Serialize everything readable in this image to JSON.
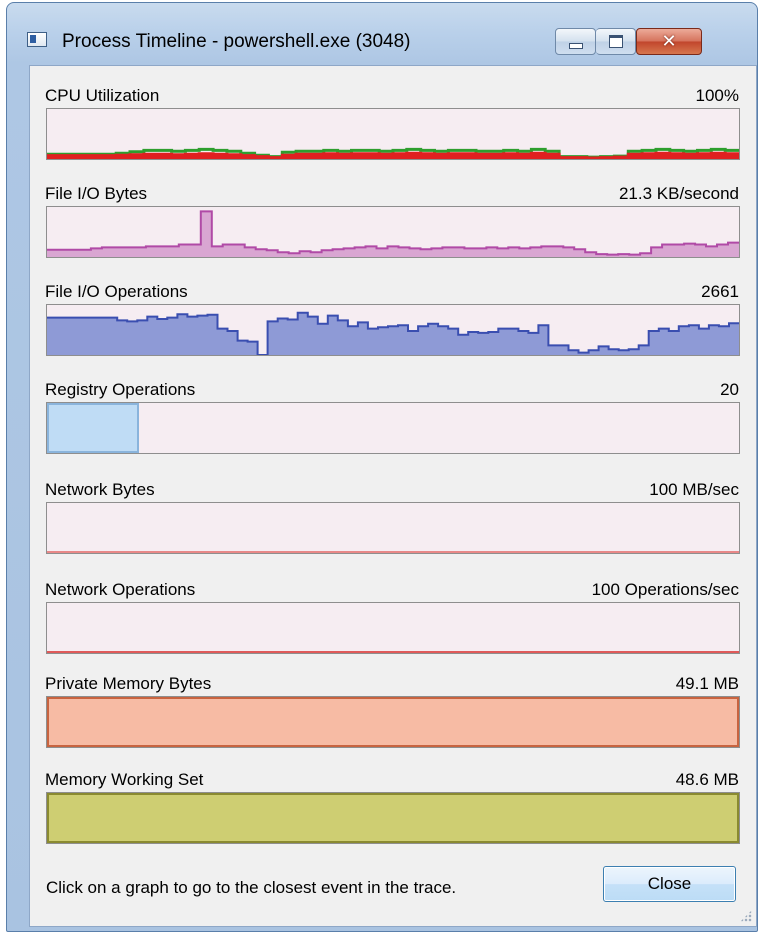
{
  "window": {
    "title": "Process Timeline - powershell.exe (3048)",
    "icons": {
      "app": "app-window-icon",
      "minimize": "minimize-icon",
      "maximize": "maximize-icon",
      "close": "close-x-icon"
    }
  },
  "graphs": [
    {
      "label": "CPU Utilization",
      "max": "100%",
      "kind": "multi-line",
      "series": [
        {
          "color": "#2e9e2e",
          "values": [
            0.1,
            0.1,
            0.1,
            0.1,
            0.1,
            0.12,
            0.15,
            0.18,
            0.18,
            0.16,
            0.18,
            0.2,
            0.18,
            0.16,
            0.12,
            0.08,
            0.05,
            0.14,
            0.16,
            0.16,
            0.18,
            0.16,
            0.18,
            0.18,
            0.16,
            0.18,
            0.2,
            0.18,
            0.16,
            0.18,
            0.18,
            0.16,
            0.16,
            0.18,
            0.16,
            0.2,
            0.16,
            0.05,
            0.05,
            0.04,
            0.05,
            0.06,
            0.16,
            0.18,
            0.2,
            0.18,
            0.16,
            0.18,
            0.2,
            0.18
          ]
        },
        {
          "color": "#e02020",
          "values": [
            0.07,
            0.07,
            0.07,
            0.07,
            0.07,
            0.08,
            0.09,
            0.1,
            0.1,
            0.09,
            0.1,
            0.11,
            0.1,
            0.09,
            0.07,
            0.05,
            0.03,
            0.08,
            0.1,
            0.1,
            0.11,
            0.1,
            0.11,
            0.11,
            0.1,
            0.11,
            0.12,
            0.11,
            0.1,
            0.11,
            0.11,
            0.1,
            0.1,
            0.11,
            0.1,
            0.12,
            0.1,
            0.03,
            0.03,
            0.02,
            0.03,
            0.04,
            0.1,
            0.11,
            0.12,
            0.11,
            0.1,
            0.11,
            0.12,
            0.11
          ]
        }
      ]
    },
    {
      "label": "File I/O Bytes",
      "max": "21.3 KB/second",
      "kind": "area",
      "fill": "#d9a6d2",
      "stroke": "#b04aa6",
      "values": [
        0.15,
        0.15,
        0.15,
        0.15,
        0.18,
        0.2,
        0.2,
        0.2,
        0.2,
        0.22,
        0.22,
        0.22,
        0.26,
        0.26,
        0.95,
        0.22,
        0.26,
        0.26,
        0.2,
        0.16,
        0.14,
        0.1,
        0.08,
        0.12,
        0.1,
        0.14,
        0.16,
        0.18,
        0.2,
        0.22,
        0.18,
        0.22,
        0.2,
        0.18,
        0.16,
        0.18,
        0.2,
        0.2,
        0.18,
        0.18,
        0.2,
        0.18,
        0.2,
        0.18,
        0.2,
        0.22,
        0.22,
        0.2,
        0.16,
        0.1,
        0.06,
        0.05,
        0.06,
        0.05,
        0.08,
        0.2,
        0.26,
        0.26,
        0.28,
        0.26,
        0.22,
        0.26,
        0.3
      ]
    },
    {
      "label": "File I/O Operations",
      "max": "2661",
      "kind": "area",
      "fill": "#8e9ad6",
      "stroke": "#3a4eb0",
      "values": [
        0.78,
        0.78,
        0.78,
        0.78,
        0.78,
        0.78,
        0.78,
        0.72,
        0.7,
        0.72,
        0.8,
        0.75,
        0.78,
        0.85,
        0.8,
        0.82,
        0.84,
        0.55,
        0.5,
        0.3,
        0.28,
        0.0,
        0.7,
        0.76,
        0.74,
        0.88,
        0.8,
        0.65,
        0.82,
        0.72,
        0.6,
        0.68,
        0.55,
        0.58,
        0.6,
        0.62,
        0.5,
        0.6,
        0.65,
        0.6,
        0.55,
        0.42,
        0.48,
        0.46,
        0.48,
        0.55,
        0.55,
        0.5,
        0.46,
        0.62,
        0.2,
        0.2,
        0.1,
        0.05,
        0.1,
        0.18,
        0.12,
        0.1,
        0.12,
        0.2,
        0.5,
        0.55,
        0.5,
        0.6,
        0.62,
        0.55,
        0.62,
        0.6,
        0.66
      ]
    },
    {
      "label": "Registry Operations",
      "max": "20",
      "kind": "block",
      "fill": "#bfdcf5",
      "stroke": "#8ab4dc",
      "fraction": 0.13
    },
    {
      "label": "Network Bytes",
      "max": "100 MB/sec",
      "kind": "baseline",
      "stroke": "#e88888"
    },
    {
      "label": "Network Operations",
      "max": "100 Operations/sec",
      "kind": "baseline",
      "stroke": "#e05a5a"
    },
    {
      "label": "Private Memory Bytes",
      "max": "49.1 MB",
      "kind": "full",
      "fill": "#f7bba4",
      "stroke": "#c86440"
    },
    {
      "label": "Memory Working Set",
      "max": "48.6 MB",
      "kind": "full",
      "fill": "#cece72",
      "stroke": "#8a8a30"
    }
  ],
  "footer": {
    "hint": "Click on a graph to go to the closest event in the trace.",
    "close_label": "Close",
    "grip_icon": "resize-grip-icon"
  }
}
